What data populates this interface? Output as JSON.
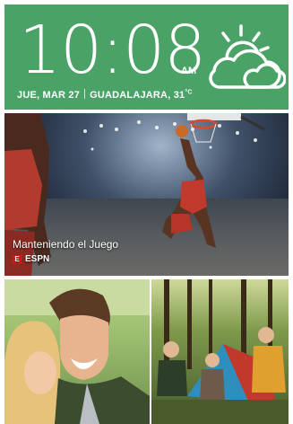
{
  "clock": {
    "time": "10:08",
    "ampm": "AM",
    "date": "JUE, MAR 27",
    "location": "GUADALAJARA,",
    "temperature": "31",
    "unit": "°C",
    "weather_icon": "partly-cloudy-sun-icon"
  },
  "feed": {
    "main_story": {
      "headline": "Manteniendo el Juego",
      "source": "ESPN",
      "source_logo_letter": "E"
    },
    "photo_cards": [
      {
        "name": "photo-couple",
        "icon": "photo"
      },
      {
        "name": "photo-camping",
        "icon": "photo"
      }
    ]
  },
  "colors": {
    "widget_bg": "#4aa267",
    "espn_red": "#d41a1a",
    "text": "#ffffff"
  }
}
